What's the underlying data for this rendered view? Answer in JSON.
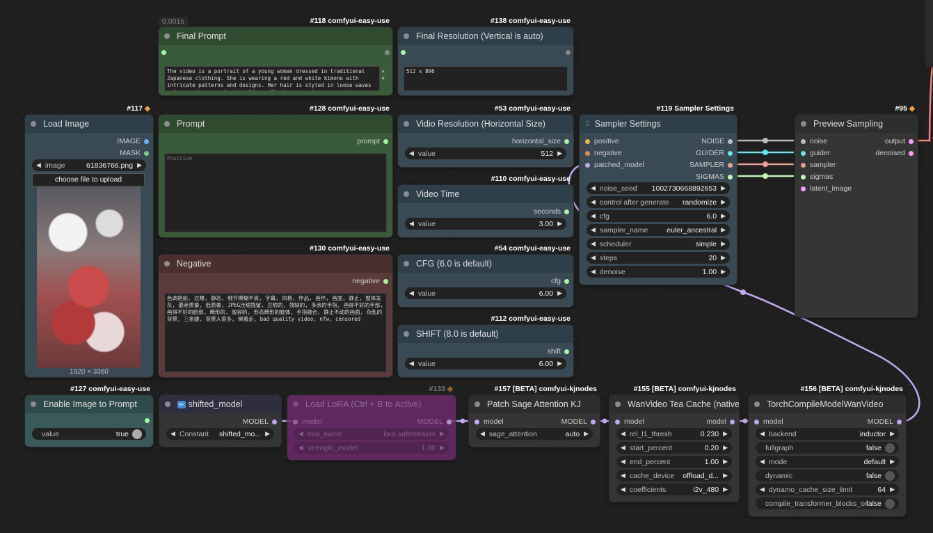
{
  "colors": {
    "positive": "#e6b84a",
    "negative": "#e08a5a",
    "model": "#c2a8f0",
    "noise": "#bdbdbd",
    "guider": "#63e6ea",
    "sampler": "#ee9d95",
    "sigmas": "#c3f5b8",
    "latent": "#ff9cf9",
    "image": "#64b5f6",
    "mask": "#81c784",
    "string": "#8bc34a"
  },
  "final_prompt": {
    "time_badge": "0.001s",
    "id": "#118 comfyui-easy-use",
    "title": "Final Prompt",
    "text": "The video is a portrait of a young woman dressed in traditional Japanese clothing. She is wearing a red and white kimono with intricate patterns and designs. Her hair is styled in loose waves and cascades over her shoulders. She has a serious expression on her face and is looking"
  },
  "final_resolution": {
    "id": "#138 comfyui-easy-use",
    "title": "Final Resolution (Vertical is auto)",
    "text": "512 x 896"
  },
  "load_image": {
    "id": "#117",
    "title": "Load Image",
    "out_image": "IMAGE",
    "out_mask": "MASK",
    "image_label": "image",
    "image_value": "61836766.png",
    "upload_label": "choose file to upload",
    "dims": "1920 × 3360"
  },
  "prompt": {
    "id": "#128 comfyui-easy-use",
    "title": "Prompt",
    "out": "prompt",
    "placeholder": "Positive"
  },
  "negative": {
    "id": "#130 comfyui-easy-use",
    "title": "Negative",
    "out": "negative",
    "text": "色调艳丽, 过曝, 静态, 细节模糊不清, 字幕, 风格, 作品, 画作, 画面, 静止, 整体发灰, 最差质量, 低质量, JPEG压缩残留, 丑陋的, 残缺的, 多余的手指, 画得不好的手部, 画得不好的脸部, 畸形的, 毁容的, 形态畸形的肢体, 手指融合, 静止不动的画面, 杂乱的背景, 三条腿, 背景人很多, 倒着走, bad quality video, nfw, censored"
  },
  "video_res": {
    "id": "#53 comfyui-easy-use",
    "title": "Vidio Resolution (Horizontal Size)",
    "out": "horizontal_size",
    "label": "value",
    "value": "512"
  },
  "video_time": {
    "id": "#110 comfyui-easy-use",
    "title": "Video Time",
    "out": "seconds",
    "label": "value",
    "value": "3.00"
  },
  "cfg": {
    "id": "#54 comfyui-easy-use",
    "title": "CFG (6.0 is default)",
    "out": "cfg",
    "label": "value",
    "value": "6.00"
  },
  "shift": {
    "id": "#112 comfyui-easy-use",
    "title": "SHIFT (8.0 is default)",
    "out": "shift",
    "label": "value",
    "value": "6.00"
  },
  "sampler_settings": {
    "id": "#119 Sampler Settings",
    "title": "Sampler Settings",
    "inputs": [
      "positive",
      "negative",
      "patched_model"
    ],
    "outputs": [
      "NOISE",
      "GUIDER",
      "SAMPLER",
      "SIGMAS"
    ],
    "widgets": [
      {
        "label": "noise_seed",
        "value": "1002730668892653"
      },
      {
        "label": "control after generate",
        "value": "randomize"
      },
      {
        "label": "cfg",
        "value": "6.0"
      },
      {
        "label": "sampler_name",
        "value": "euler_ancestral"
      },
      {
        "label": "scheduler",
        "value": "simple"
      },
      {
        "label": "steps",
        "value": "20"
      },
      {
        "label": "denoise",
        "value": "1.00"
      }
    ]
  },
  "preview": {
    "id": "#95",
    "title": "Preview Sampling",
    "inputs": [
      "noise",
      "guider",
      "sampler",
      "sigmas",
      "latent_image"
    ],
    "outputs": [
      "output",
      "denoised"
    ]
  },
  "enable_image": {
    "id": "#127 comfyui-easy-use",
    "title": "Enable Image to Prompt",
    "label": "value",
    "value": "true"
  },
  "shifted": {
    "title": "shifted_model",
    "out": "MODEL",
    "label": "Constant",
    "value": "shifted_mo..."
  },
  "lora": {
    "id": "#133",
    "title": "Load LoRA (Ctrl + B to Active)",
    "in": "model",
    "out": "MODEL",
    "widgets": [
      {
        "label": "lora_name",
        "value": "lora.safetensors"
      },
      {
        "label": "strength_model",
        "value": "1.00"
      }
    ]
  },
  "sage": {
    "id": "#157 [BETA] comfyui-kjnodes",
    "title": "Patch Sage Attention KJ",
    "in": "model",
    "out": "MODEL",
    "label": "sage_attention",
    "value": "auto"
  },
  "teacache": {
    "id": "#155 [BETA] comfyui-kjnodes",
    "title": "WanVideo Tea Cache (native)",
    "in": "model",
    "out": "model",
    "widgets": [
      {
        "label": "rel_l1_thresh",
        "value": "0.230"
      },
      {
        "label": "start_percent",
        "value": "0.20"
      },
      {
        "label": "end_percent",
        "value": "1.00"
      },
      {
        "label": "cache_device",
        "value": "offload_d..."
      },
      {
        "label": "coefficients",
        "value": "i2v_480"
      }
    ]
  },
  "torch": {
    "id": "#156 [BETA] comfyui-kjnodes",
    "title": "TorchCompileModelWanVideo",
    "in": "model",
    "out": "MODEL",
    "widgets": [
      {
        "label": "backend",
        "value": "inductor",
        "type": "combo"
      },
      {
        "label": "fullgraph",
        "value": "false",
        "type": "toggle"
      },
      {
        "label": "mode",
        "value": "default",
        "type": "combo"
      },
      {
        "label": "dynamic",
        "value": "false",
        "type": "toggle"
      },
      {
        "label": "dynamo_cache_size_limit",
        "value": "64",
        "type": "combo"
      },
      {
        "label": "compile_transformer_blocks_only",
        "value": "false",
        "type": "toggle"
      }
    ]
  }
}
